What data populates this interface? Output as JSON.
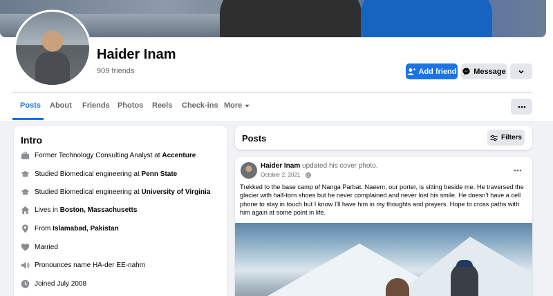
{
  "profile": {
    "name": "Haider Inam",
    "friends_count": "909 friends"
  },
  "actions": {
    "add_friend": "Add friend",
    "message": "Message"
  },
  "tabs": [
    {
      "label": "Posts",
      "active": true
    },
    {
      "label": "About"
    },
    {
      "label": "Friends"
    },
    {
      "label": "Photos"
    },
    {
      "label": "Reels"
    },
    {
      "label": "Check-ins"
    },
    {
      "label": "More"
    }
  ],
  "intro": {
    "title": "Intro",
    "items": [
      {
        "icon": "briefcase-icon",
        "text": "Former Technology Consulting Analyst at ",
        "bold": "Accenture"
      },
      {
        "icon": "graduation-cap-icon",
        "text": "Studied Biomedical engineering at ",
        "bold": "Penn State"
      },
      {
        "icon": "graduation-cap-icon",
        "text": "Studied Biomedical engineering at ",
        "bold": "University of Virginia"
      },
      {
        "icon": "home-icon",
        "text": "Lives in ",
        "bold": "Boston, Massachusetts"
      },
      {
        "icon": "location-pin-icon",
        "text": "From ",
        "bold": "Islamabad, Pakistan"
      },
      {
        "icon": "heart-icon",
        "text": "Married",
        "bold": ""
      },
      {
        "icon": "speaker-icon",
        "text": "Pronounces name HA-der EE-nahm",
        "bold": ""
      },
      {
        "icon": "clock-icon",
        "text": "Joined July 2008",
        "bold": ""
      }
    ]
  },
  "posts_section": {
    "title": "Posts",
    "filters_label": "Filters"
  },
  "post": {
    "author": "Haider Inam",
    "action": " updated his cover photo.",
    "date": "October 2, 2021 ·",
    "text": "Trekked to the base camp of Nanga Parbat. Naeem, our porter, is sitting beside me. He traversed the glacier with half-torn shoes but he never complained and never lost his smile. He doesn't have a cell phone to stay in touch but I know I'll have him in my thoughts and prayers. Hope to cross paths with him again at some point in life."
  },
  "colors": {
    "accent": "#1b74e4",
    "page_bg": "#f0f2f5",
    "muted_text": "#65676b",
    "button_gray": "#e4e6eb"
  }
}
